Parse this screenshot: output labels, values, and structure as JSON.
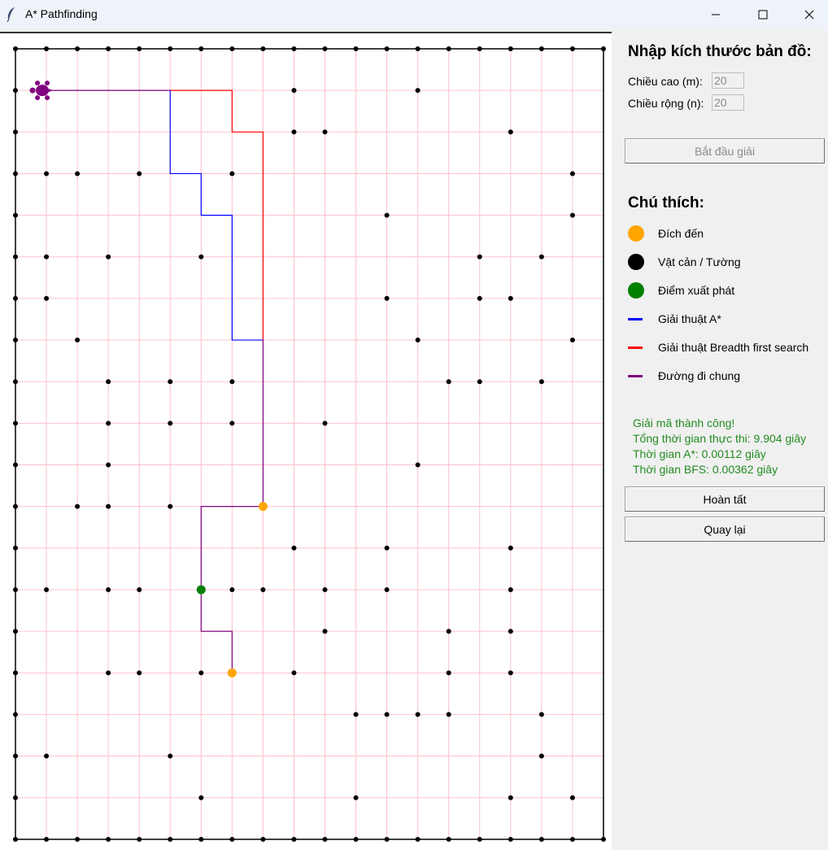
{
  "window": {
    "title": "A* Pathfinding",
    "icon": "feather-icon"
  },
  "grid": {
    "rows": 20,
    "cols": 20,
    "colors": {
      "grid_line": "#ffc0cb",
      "obstacle": "#000000",
      "border": "#000000"
    },
    "obstacles": [
      [
        0,
        0
      ],
      [
        0,
        1
      ],
      [
        0,
        2
      ],
      [
        0,
        3
      ],
      [
        0,
        4
      ],
      [
        0,
        5
      ],
      [
        0,
        6
      ],
      [
        0,
        7
      ],
      [
        0,
        8
      ],
      [
        0,
        9
      ],
      [
        0,
        10
      ],
      [
        0,
        11
      ],
      [
        0,
        12
      ],
      [
        0,
        13
      ],
      [
        0,
        14
      ],
      [
        0,
        15
      ],
      [
        0,
        16
      ],
      [
        0,
        17
      ],
      [
        0,
        18
      ],
      [
        0,
        19
      ],
      [
        1,
        0
      ],
      [
        1,
        9
      ],
      [
        1,
        13
      ],
      [
        2,
        0
      ],
      [
        2,
        9
      ],
      [
        2,
        10
      ],
      [
        2,
        16
      ],
      [
        3,
        0
      ],
      [
        3,
        1
      ],
      [
        3,
        2
      ],
      [
        3,
        4
      ],
      [
        3,
        7
      ],
      [
        3,
        18
      ],
      [
        4,
        0
      ],
      [
        4,
        12
      ],
      [
        4,
        18
      ],
      [
        5,
        0
      ],
      [
        5,
        1
      ],
      [
        5,
        3
      ],
      [
        5,
        6
      ],
      [
        5,
        15
      ],
      [
        5,
        17
      ],
      [
        6,
        0
      ],
      [
        6,
        1
      ],
      [
        6,
        12
      ],
      [
        6,
        15
      ],
      [
        6,
        16
      ],
      [
        7,
        0
      ],
      [
        7,
        2
      ],
      [
        7,
        13
      ],
      [
        7,
        18
      ],
      [
        8,
        0
      ],
      [
        8,
        3
      ],
      [
        8,
        5
      ],
      [
        8,
        7
      ],
      [
        8,
        14
      ],
      [
        8,
        15
      ],
      [
        8,
        17
      ],
      [
        9,
        0
      ],
      [
        9,
        3
      ],
      [
        9,
        5
      ],
      [
        9,
        7
      ],
      [
        9,
        10
      ],
      [
        10,
        0
      ],
      [
        10,
        3
      ],
      [
        10,
        13
      ],
      [
        11,
        0
      ],
      [
        11,
        2
      ],
      [
        11,
        3
      ],
      [
        11,
        5
      ],
      [
        12,
        0
      ],
      [
        12,
        9
      ],
      [
        12,
        12
      ],
      [
        12,
        16
      ],
      [
        13,
        0
      ],
      [
        13,
        1
      ],
      [
        13,
        3
      ],
      [
        13,
        4
      ],
      [
        13,
        7
      ],
      [
        13,
        8
      ],
      [
        13,
        10
      ],
      [
        13,
        12
      ],
      [
        13,
        16
      ],
      [
        14,
        0
      ],
      [
        14,
        10
      ],
      [
        14,
        14
      ],
      [
        14,
        16
      ],
      [
        15,
        0
      ],
      [
        15,
        3
      ],
      [
        15,
        4
      ],
      [
        15,
        6
      ],
      [
        15,
        9
      ],
      [
        15,
        14
      ],
      [
        15,
        16
      ],
      [
        16,
        0
      ],
      [
        16,
        11
      ],
      [
        16,
        12
      ],
      [
        16,
        13
      ],
      [
        16,
        14
      ],
      [
        16,
        17
      ],
      [
        17,
        0
      ],
      [
        17,
        1
      ],
      [
        17,
        5
      ],
      [
        17,
        17
      ],
      [
        18,
        0
      ],
      [
        18,
        6
      ],
      [
        18,
        11
      ],
      [
        18,
        16
      ],
      [
        18,
        18
      ],
      [
        19,
        0
      ],
      [
        19,
        1
      ],
      [
        19,
        2
      ],
      [
        19,
        3
      ],
      [
        19,
        4
      ],
      [
        19,
        5
      ],
      [
        19,
        6
      ],
      [
        19,
        7
      ],
      [
        19,
        8
      ],
      [
        19,
        9
      ],
      [
        19,
        10
      ],
      [
        19,
        11
      ],
      [
        19,
        12
      ],
      [
        19,
        13
      ],
      [
        19,
        14
      ],
      [
        19,
        15
      ],
      [
        19,
        16
      ],
      [
        19,
        17
      ],
      [
        19,
        18
      ],
      [
        19,
        19
      ]
    ],
    "goals": [
      [
        11,
        8
      ],
      [
        15,
        7
      ]
    ],
    "start": [
      13,
      6
    ],
    "agent": [
      1,
      1
    ],
    "paths": {
      "astar": {
        "color": "#0000ff",
        "cells": [
          [
            1,
            5
          ],
          [
            3,
            5
          ],
          [
            3,
            6
          ],
          [
            4,
            6
          ],
          [
            4,
            7
          ],
          [
            7,
            7
          ],
          [
            7,
            8
          ]
        ]
      },
      "bfs": {
        "color": "#ff0000",
        "cells": [
          [
            1,
            5
          ],
          [
            1,
            7
          ],
          [
            2,
            7
          ],
          [
            2,
            8
          ],
          [
            7,
            8
          ]
        ]
      },
      "common": {
        "color": "#800080",
        "cells": [
          [
            1,
            1
          ],
          [
            1,
            5
          ]
        ]
      },
      "common2": {
        "color": "#800080",
        "cells": [
          [
            7,
            8
          ],
          [
            11,
            8
          ],
          [
            11,
            6
          ],
          [
            14,
            6
          ],
          [
            14,
            7
          ],
          [
            15,
            7
          ]
        ]
      }
    }
  },
  "panel": {
    "map_size_heading": "Nhập kích thước bản đồ:",
    "height_label": "Chiều cao (m):",
    "height_value": "20",
    "width_label": "Chiều rộng (n):",
    "width_value": "20",
    "start_button": "Bắt đầu giải",
    "legend_heading": "Chú thích:",
    "legend": [
      {
        "label": "Đích đến",
        "color": "#ffa500",
        "kind": "dot"
      },
      {
        "label": "Vật cản / Tường",
        "color": "#000000",
        "kind": "dot"
      },
      {
        "label": "Điểm xuất phát",
        "color": "#008000",
        "kind": "dot"
      },
      {
        "label": "Giải thuật A*",
        "color": "#0000ff",
        "kind": "line"
      },
      {
        "label": "Giải thuật Breadth first search",
        "color": "#ff0000",
        "kind": "line"
      },
      {
        "label": "Đường đi chung",
        "color": "#800080",
        "kind": "line"
      }
    ],
    "status": {
      "line1": "Giải mã thành công!",
      "line2": "Tổng thời gian thực thi: 9.904 giây",
      "line3": "Thời gian A*: 0.00112 giây",
      "line4": "Thời gian BFS: 0.00362 giây",
      "color": "#228b22"
    },
    "finish_button": "Hoàn tất",
    "back_button": "Quay lại"
  }
}
